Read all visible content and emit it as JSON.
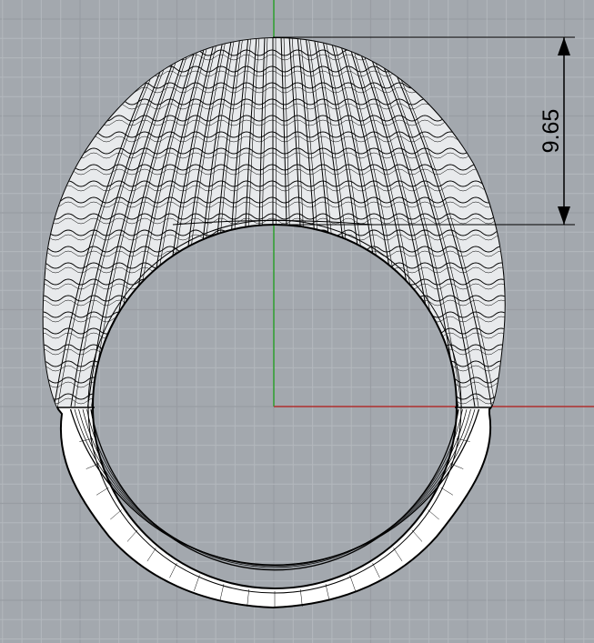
{
  "viewport": {
    "background_color": "#a3a8ae",
    "grid_minor_color": "#b3b8bd",
    "grid_major_color": "#989da3",
    "x_axis_color": "#b03030",
    "y_axis_color": "#2ea02e",
    "model_fill_color": "#ffffff",
    "model_wire_color": "#000000",
    "gap_fill_color": "#9aa0a6"
  },
  "dimension": {
    "value": "9.65",
    "line_color": "#000000",
    "orientation": "vertical"
  },
  "model": {
    "name": "ring",
    "view": "front"
  }
}
